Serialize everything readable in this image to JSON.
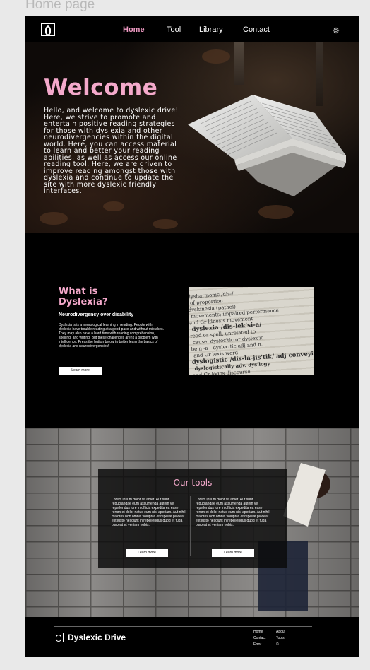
{
  "frame_label": "Home page",
  "nav": {
    "links": [
      "Home",
      "Tool",
      "Library",
      "Contact"
    ],
    "active": "Home",
    "settings_icon": "gear-icon"
  },
  "hero": {
    "title": "Welcome",
    "body": "Hello, and welcome to dyslexic drive! Here, we strive to promote and entertain positive reading strategies for those with dyslexia and other neurodivergencies within the digital world. Here, you can access material to learn and better your reading abilities, as well as access our online reading tool. Here, we are driven to improve reading amongst those with dyslexia and continue to update the site with more dyslexic friendly interfaces."
  },
  "dyslexia": {
    "title": "What is Dyslexia?",
    "subtitle": "Neurodivergency over disability",
    "body": "Dyslexia is is a neurological learning  in reading. People with dyslexia have trouble reading at a good pace and without mistakes. They may also have a hard time with reading comprehension, spelling, and writing. But these challenges aren't a problem with intelligence. Press the button below to better learn the basics of dyslexia and neurodivergencies!",
    "button": "Learn more",
    "dictionary_lines": [
      "dysharmonic  /dis-/",
      "of proportion.",
      "dyskinesia  (pathol)",
      "movements; impaired performance",
      "and Gr kinesis movement",
      "dyslexia  /dis-lek'si-a/",
      "read or spell, unrelated to",
      "cause.  dyslec'tic or dyslex'ic",
      "be  n  -a -  dyslec'tic  adj and n.",
      "and Gr lexis word",
      "dyslogistic  /dis-la-jis'tik/  adj conveying",
      "dyslogistically  adv.  dys'logy",
      "and Gr logos discourse"
    ]
  },
  "tools": {
    "title": "Our tools",
    "columns": [
      {
        "text": "Lorem ipsum dolor sit amet. Aut sunt repudiandae eum assumenda autem vel repellendus iure in officia expedita ea esse rerum et dolor natus eum nisi aperiam. Aut nihil maiores non omnis voluptas et repellat placeat est iusto nesciunt in repellendus quod et fuga placeat et veniam nobis.",
        "button": "Learn more"
      },
      {
        "text": "Lorem ipsum dolor sit amet. Aut sunt repudiandae eum assumenda autem vel repellendus iure in officia expedita ea esse rerum et dolor natus eum nisi aperiam. Aut nihil maiores non omnis voluptas et repellat placeat est iusto nesciunt in repellendus quod et fuga placeat et veniam nobis.",
        "button": "Learn more"
      }
    ]
  },
  "footer": {
    "brand": "Dyslexic Drive",
    "links": [
      "Home",
      "About",
      "Contact",
      "Tools",
      "Error",
      "©"
    ]
  },
  "colors": {
    "accent_pink": "#f4a9cb",
    "nav_active": "#ef9ac3",
    "background": "#000000"
  }
}
